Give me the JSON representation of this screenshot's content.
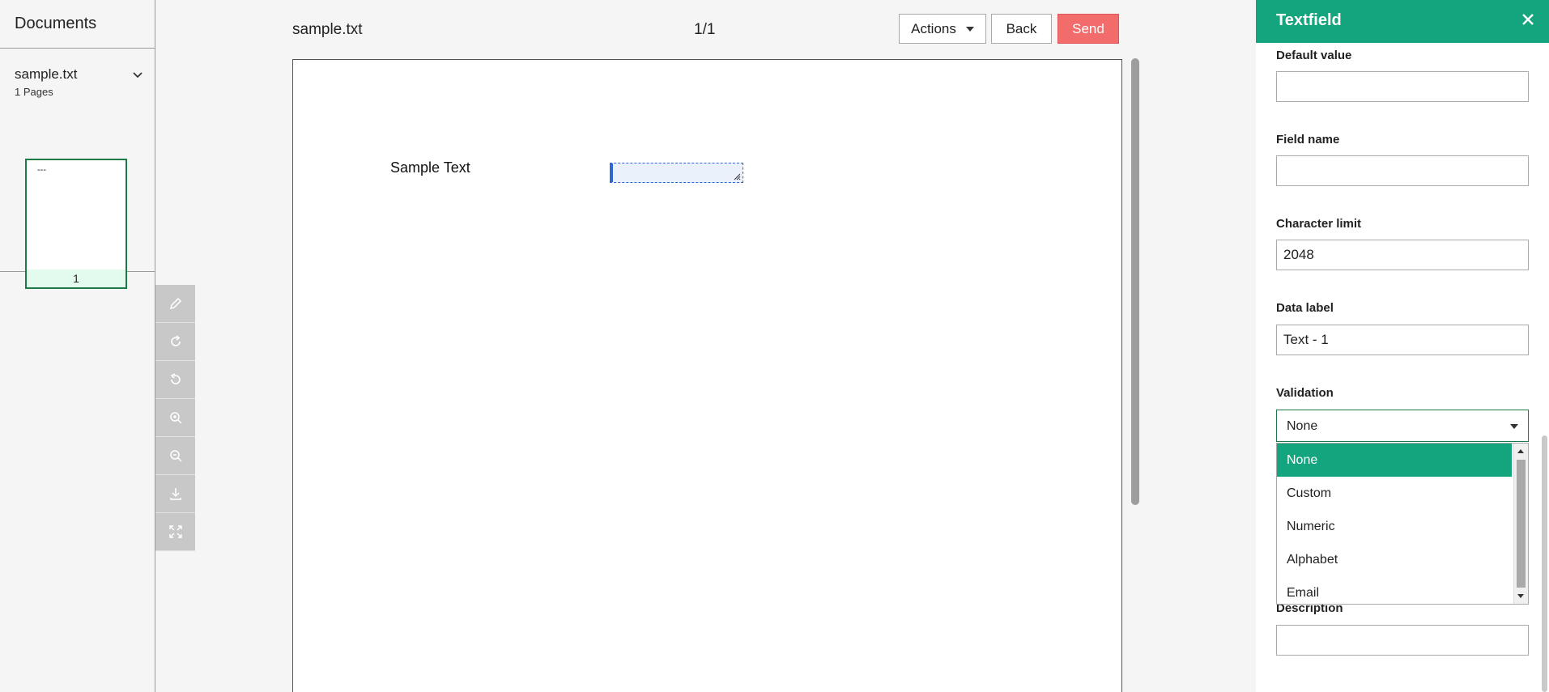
{
  "sidebar": {
    "title": "Documents",
    "document": {
      "name": "sample.txt",
      "pages": "1 Pages",
      "thumb_text": "---",
      "thumb_page": "1"
    }
  },
  "toolbar": {
    "tools": [
      "pencil-icon",
      "rotate-cw-icon",
      "undo-icon",
      "zoom-in-icon",
      "zoom-out-icon",
      "download-icon",
      "fullscreen-icon"
    ]
  },
  "viewer": {
    "file_title": "sample.txt",
    "page_counter": "1/1",
    "actions_label": "Actions",
    "back_label": "Back",
    "send_label": "Send",
    "page_text": "Sample Text"
  },
  "panel": {
    "title": "Textfield",
    "default_value": {
      "label": "Default value",
      "value": ""
    },
    "field_name": {
      "label": "Field name",
      "value": ""
    },
    "char_limit": {
      "label": "Character limit",
      "value": "2048"
    },
    "data_label": {
      "label": "Data label",
      "value": "Text - 1"
    },
    "validation": {
      "label": "Validation",
      "selected": "None",
      "options": [
        "None",
        "Custom",
        "Numeric",
        "Alphabet",
        "Email"
      ]
    },
    "description": {
      "label": "Description",
      "value": ""
    }
  },
  "colors": {
    "accent": "#14a57f",
    "send": "#f26c6c",
    "selection": "#2f68d6"
  }
}
